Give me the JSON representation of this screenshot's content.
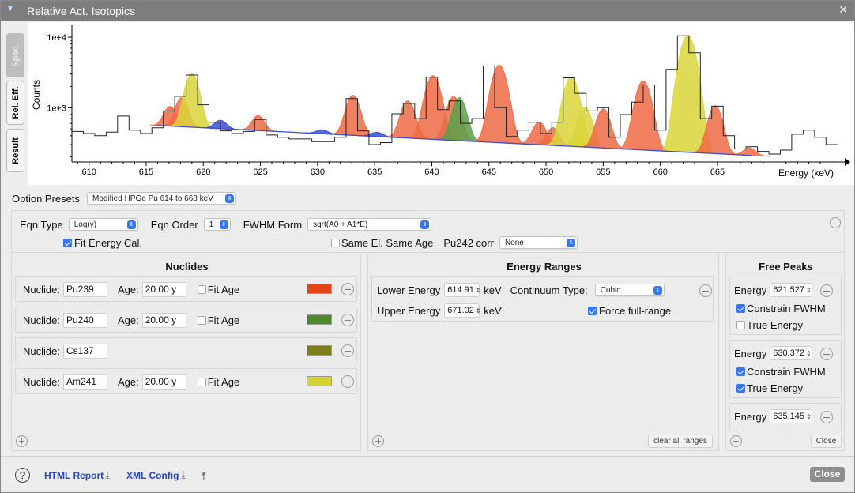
{
  "window": {
    "title": "Relative Act. Isotopics"
  },
  "tabs": [
    {
      "label": "Spec."
    },
    {
      "label": "Rel. Eff."
    },
    {
      "label": "Result"
    }
  ],
  "chart_data": {
    "type": "line",
    "xlabel": "Energy (keV)",
    "ylabel": "Counts",
    "xlim": [
      608.5,
      676
    ],
    "ylim": [
      170,
      14000
    ],
    "y_scale": "log",
    "x_ticks": [
      "610",
      "615",
      "620",
      "625",
      "630",
      "635",
      "640",
      "645",
      "650",
      "655",
      "660",
      "665"
    ],
    "y_ticks": [
      "1e+3",
      "1e+4"
    ],
    "series": [
      {
        "values": [
          [
            609,
            460
          ],
          [
            610,
            430
          ],
          [
            611,
            400
          ],
          [
            612,
            450
          ],
          [
            613,
            760
          ],
          [
            614,
            480
          ],
          [
            615,
            430
          ],
          [
            616,
            520
          ],
          [
            617,
            900
          ],
          [
            618,
            1450
          ],
          [
            619,
            2900
          ],
          [
            620,
            1100
          ],
          [
            621,
            620
          ],
          [
            622,
            470
          ],
          [
            623,
            430
          ],
          [
            624,
            460
          ],
          [
            625,
            680
          ],
          [
            626,
            410
          ],
          [
            627,
            380
          ],
          [
            628,
            360
          ],
          [
            629,
            360
          ],
          [
            630,
            330
          ],
          [
            631,
            330
          ],
          [
            632,
            380
          ],
          [
            633,
            1350
          ],
          [
            634,
            470
          ],
          [
            635,
            300
          ],
          [
            636,
            320
          ],
          [
            637,
            820
          ],
          [
            638,
            1150
          ],
          [
            639,
            700
          ],
          [
            640,
            2700
          ],
          [
            641,
            940
          ],
          [
            642,
            1250
          ],
          [
            643,
            600
          ],
          [
            644,
            700
          ],
          [
            645,
            3900
          ],
          [
            646,
            1000
          ],
          [
            647,
            390
          ],
          [
            648,
            480
          ],
          [
            649,
            620
          ],
          [
            650,
            430
          ],
          [
            651,
            620
          ],
          [
            652,
            2650
          ],
          [
            653,
            1600
          ],
          [
            654,
            900
          ],
          [
            655,
            1000
          ],
          [
            656,
            380
          ],
          [
            657,
            800
          ],
          [
            658,
            1200
          ],
          [
            659,
            2100
          ],
          [
            660,
            480
          ],
          [
            661,
            3500
          ],
          [
            662,
            10500
          ],
          [
            663,
            6000
          ],
          [
            664,
            700
          ],
          [
            665,
            1050
          ],
          [
            666,
            400
          ],
          [
            667,
            260
          ],
          [
            668,
            280
          ],
          [
            669,
            240
          ],
          [
            670,
            220
          ],
          [
            671,
            250
          ],
          [
            672,
            420
          ],
          [
            673,
            480
          ],
          [
            674,
            380
          ],
          [
            675,
            300
          ]
        ]
      }
    ],
    "peaks": [
      {
        "e": 617.1,
        "a": 500,
        "w": 0.5,
        "color": "#ee6a44"
      },
      {
        "e": 618.1,
        "a": 850,
        "w": 0.5,
        "color": "#ee6a44"
      },
      {
        "e": 619.0,
        "a": 2500,
        "w": 0.55,
        "color": "#d9d53a"
      },
      {
        "e": 621.5,
        "a": 160,
        "w": 0.5,
        "color": "#3d4ed8"
      },
      {
        "e": 624.8,
        "a": 300,
        "w": 0.5,
        "color": "#ee6a44"
      },
      {
        "e": 630.4,
        "a": 60,
        "w": 0.5,
        "color": "#3d4ed8"
      },
      {
        "e": 633.1,
        "a": 1100,
        "w": 0.55,
        "color": "#ee6a44"
      },
      {
        "e": 635.2,
        "a": 60,
        "w": 0.5,
        "color": "#3d4ed8"
      },
      {
        "e": 637.9,
        "a": 880,
        "w": 0.55,
        "color": "#ee6a44"
      },
      {
        "e": 640.1,
        "a": 2500,
        "w": 0.6,
        "color": "#ee6a44"
      },
      {
        "e": 641.9,
        "a": 1100,
        "w": 0.55,
        "color": "#ee6a44"
      },
      {
        "e": 642.4,
        "a": 1050,
        "w": 0.55,
        "color": "#5aa04a"
      },
      {
        "e": 645.9,
        "a": 3700,
        "w": 0.6,
        "color": "#ee6a44"
      },
      {
        "e": 649.4,
        "a": 330,
        "w": 0.55,
        "color": "#ee6a44"
      },
      {
        "e": 650.6,
        "a": 230,
        "w": 0.5,
        "color": "#ee6a44"
      },
      {
        "e": 652.2,
        "a": 2450,
        "w": 0.6,
        "color": "#d9d53a"
      },
      {
        "e": 653.4,
        "a": 750,
        "w": 0.55,
        "color": "#d9d53a"
      },
      {
        "e": 655.0,
        "a": 700,
        "w": 0.55,
        "color": "#ee6a44"
      },
      {
        "e": 658.5,
        "a": 2150,
        "w": 0.6,
        "color": "#ee6a44"
      },
      {
        "e": 662.4,
        "a": 10300,
        "w": 0.62,
        "color": "#d9d53a"
      },
      {
        "e": 664.8,
        "a": 850,
        "w": 0.55,
        "color": "#ee6a44"
      },
      {
        "e": 667.8,
        "a": 60,
        "w": 0.5,
        "color": "#ee6a44"
      }
    ],
    "continuum": [
      [
        616,
        560
      ],
      [
        668,
        210
      ]
    ]
  },
  "option_presets": {
    "label": "Option Presets",
    "value": "Modified HPGe Pu 614 to 668 keV"
  },
  "eqn": {
    "type_label": "Eqn Type",
    "type_value": "Log(y)",
    "order_label": "Eqn Order",
    "order_value": "1",
    "fwhm_label": "FWHM Form",
    "fwhm_value": "sqrt(A0 + A1*E)",
    "fit_energy_label": "Fit Energy Cal.",
    "fit_energy_checked": true,
    "same_el_label": "Same El. Same Age",
    "same_el_checked": false,
    "pu242_label": "Pu242 corr",
    "pu242_value": "None"
  },
  "nuclides": {
    "title": "Nuclides",
    "nuclide_label": "Nuclide:",
    "age_label": "Age:",
    "fit_age_label": "Fit Age",
    "items": [
      {
        "name": "Pu239",
        "age": "20.00 y",
        "has_age": true,
        "fit_age": false,
        "color": "#e2451a"
      },
      {
        "name": "Pu240",
        "age": "20.00 y",
        "has_age": true,
        "fit_age": false,
        "color": "#4c8a2d"
      },
      {
        "name": "Cs137",
        "age": "",
        "has_age": false,
        "fit_age": false,
        "color": "#7d7d1e"
      },
      {
        "name": "Am241",
        "age": "20.00 y",
        "has_age": true,
        "fit_age": false,
        "color": "#d3d331"
      }
    ]
  },
  "energy_ranges": {
    "title": "Energy Ranges",
    "lower_label": "Lower Energy",
    "lower_value": "614.91",
    "upper_label": "Upper Energy",
    "upper_value": "671.02",
    "unit": "keV",
    "continuum_label": "Continuum Type:",
    "continuum_value": "Cubic",
    "force_label": "Force full-range",
    "force_checked": true,
    "clear_label": "clear all ranges"
  },
  "free_peaks": {
    "title": "Free Peaks",
    "energy_label": "Energy",
    "constrain_label": "Constrain FWHM",
    "true_label": "True Energy",
    "items": [
      {
        "energy": "621.527",
        "constrain": true,
        "true_energy": false
      },
      {
        "energy": "630.372",
        "constrain": true,
        "true_energy": true
      },
      {
        "energy": "635.145",
        "constrain": true,
        "true_energy": false
      }
    ],
    "close_label": "Close"
  },
  "footer": {
    "help": "?",
    "html_report": "HTML Report",
    "xml_config": "XML Config",
    "close": "Close"
  }
}
